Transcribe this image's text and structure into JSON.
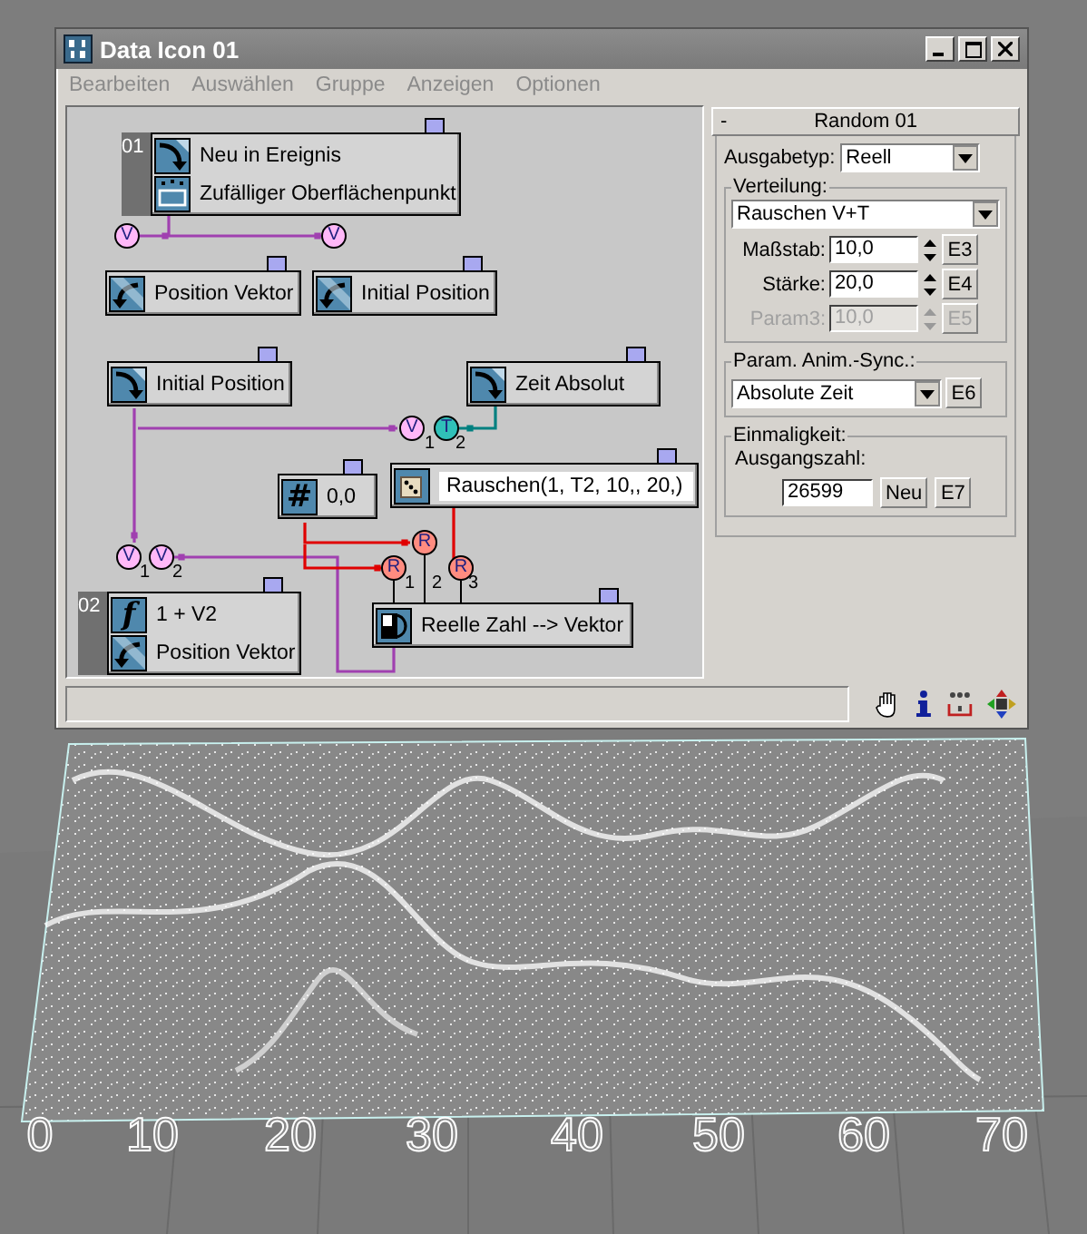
{
  "window": {
    "title": "Data Icon 01"
  },
  "menu": [
    "Bearbeiten",
    "Auswählen",
    "Gruppe",
    "Anzeigen",
    "Optionen"
  ],
  "graph": {
    "nodes": [
      {
        "tag": "01",
        "rows": [
          {
            "kind": "birth",
            "label": "Neu in Ereignis"
          },
          {
            "kind": "surface",
            "label": "Zufälliger Oberflächenpunkt"
          }
        ]
      },
      {
        "rows": [
          {
            "kind": "output",
            "label": "Position Vektor"
          }
        ]
      },
      {
        "rows": [
          {
            "kind": "output",
            "label": "Initial Position"
          }
        ]
      },
      {
        "rows": [
          {
            "kind": "input",
            "label": "Initial Position"
          }
        ]
      },
      {
        "rows": [
          {
            "kind": "input",
            "label": "Zeit Absolut"
          }
        ]
      },
      {
        "rows": [
          {
            "kind": "constant",
            "symbol": "#",
            "label": "0,0"
          }
        ]
      },
      {
        "rows": [
          {
            "kind": "random",
            "label": "Rauschen(1, T2, 10,, 20,)"
          }
        ]
      },
      {
        "tag": "02",
        "rows": [
          {
            "kind": "function",
            "symbol": "f",
            "label": "1 + V2"
          },
          {
            "kind": "output",
            "label": "Position Vektor"
          }
        ]
      },
      {
        "rows": [
          {
            "kind": "convert",
            "label": "Reelle Zahl --> Vektor"
          }
        ]
      }
    ],
    "ports": [
      {
        "letter": "V",
        "color": "#ffb8f8"
      },
      {
        "letter": "V",
        "color": "#ffb8f8"
      },
      {
        "letter": "V",
        "color": "#ffb8f8"
      },
      {
        "letter": "T",
        "color": "#30c0b8"
      },
      {
        "letter": "R",
        "color": "#ff8c80"
      },
      {
        "letter": "R",
        "color": "#ff8c80"
      },
      {
        "letter": "R",
        "color": "#ff8c80"
      },
      {
        "letter": "V",
        "color": "#ffb8f8"
      },
      {
        "letter": "V",
        "color": "#ffb8f8"
      }
    ],
    "port_numbers": [
      "1",
      "2",
      "1",
      "2",
      "1",
      "2",
      "3"
    ]
  },
  "rollout": {
    "collapse": "-",
    "title": "Random 01",
    "output_type": {
      "label": "Ausgabetyp:",
      "value": "Reell"
    },
    "groups": [
      {
        "kind": "distribution",
        "title": "Verteilung:",
        "dropdown": "Rauschen V+T",
        "params": [
          {
            "label": "Maßstab:",
            "value": "10,0",
            "key": "E3",
            "disabled": false
          },
          {
            "label": "Stärke:",
            "value": "20,0",
            "key": "E4",
            "disabled": false
          },
          {
            "label": "Param3:",
            "value": "10,0",
            "key": "E5",
            "disabled": true
          }
        ]
      },
      {
        "kind": "sync",
        "title": "Param. Anim.-Sync.:",
        "dropdown": "Absolute Zeit",
        "key": "E6"
      },
      {
        "kind": "seed",
        "title": "Einmaligkeit:",
        "seed_label": "Ausgangszahl:",
        "seed": "26599",
        "button": "Neu",
        "key": "E7"
      }
    ]
  },
  "viewport": {
    "labels": [
      "0",
      "10",
      "20",
      "30",
      "40",
      "50",
      "60",
      "70"
    ]
  }
}
